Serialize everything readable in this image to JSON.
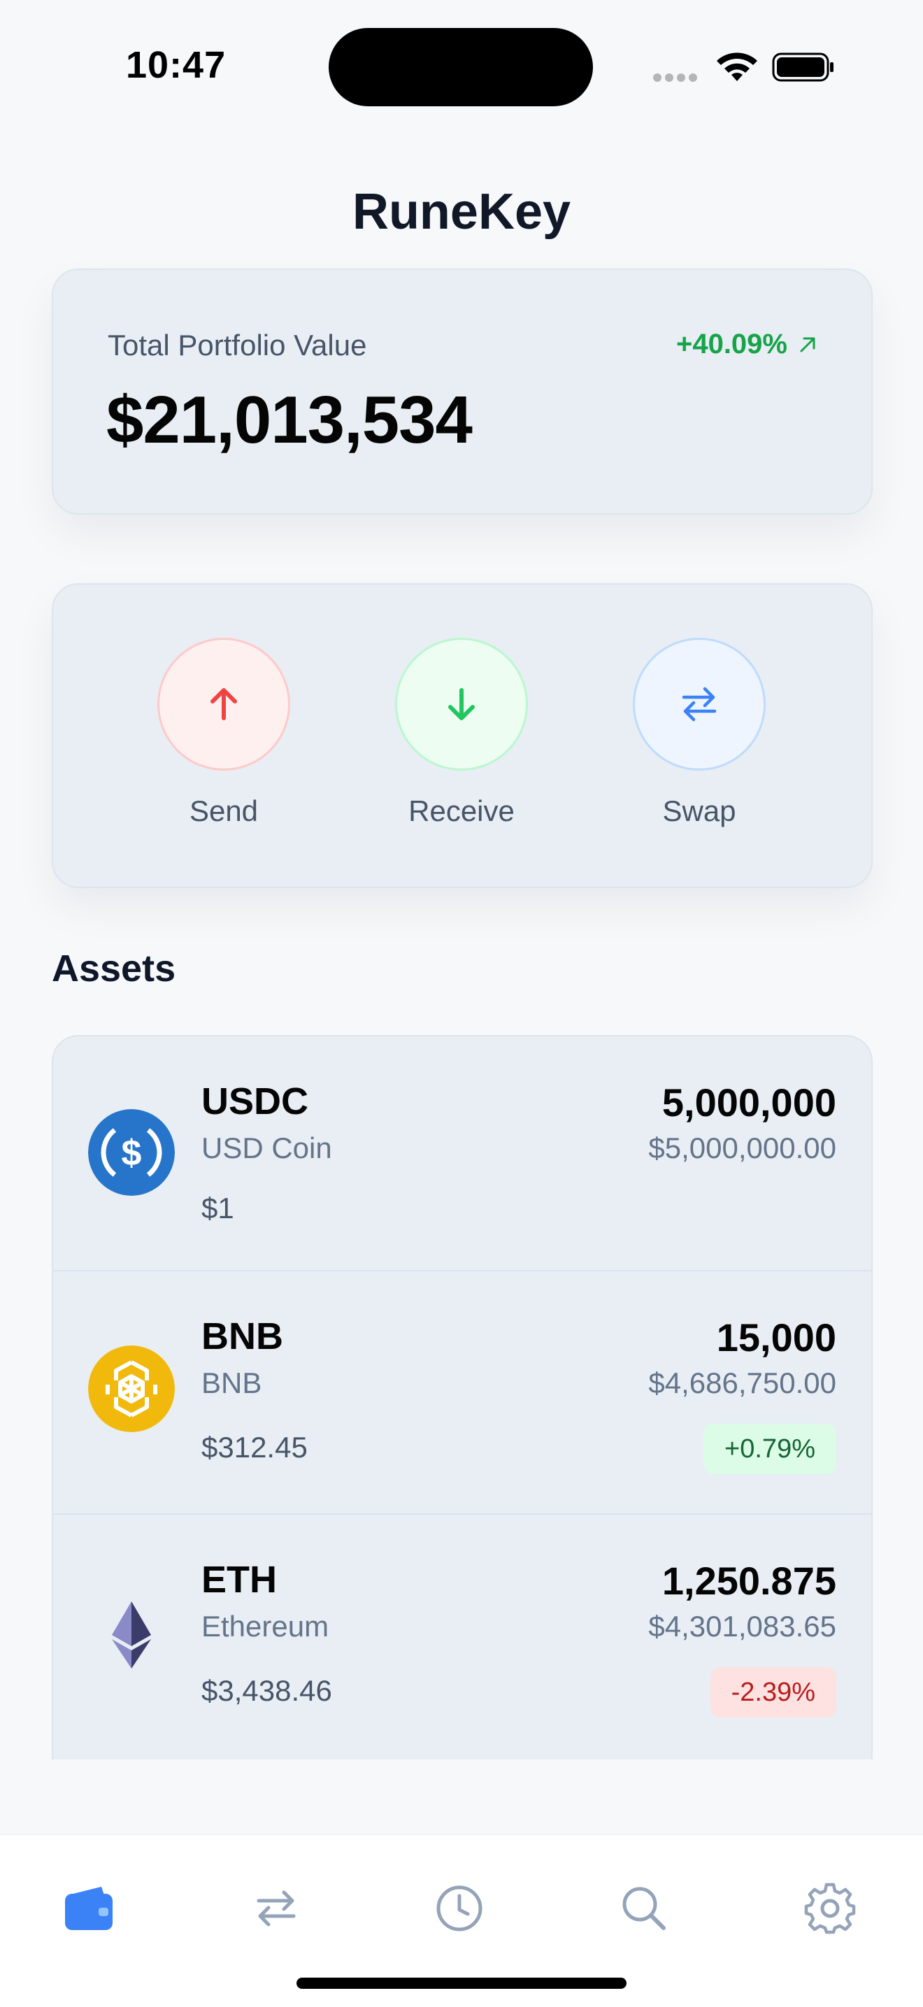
{
  "status_bar": {
    "time": "10:47"
  },
  "app": {
    "title": "RuneKey"
  },
  "portfolio": {
    "label": "Total Portfolio Value",
    "value": "$21,013,534",
    "change": "+40.09%",
    "change_icon": "arrow-up-right-icon",
    "positive_color": "#16a34a"
  },
  "actions": [
    {
      "label": "Send",
      "icon": "arrow-up-icon",
      "color": "#ef4444"
    },
    {
      "label": "Receive",
      "icon": "arrow-down-icon",
      "color": "#22c55e"
    },
    {
      "label": "Swap",
      "icon": "swap-arrows-icon",
      "color": "#3b82f6"
    }
  ],
  "assets": {
    "heading": "Assets",
    "items": [
      {
        "symbol": "USDC",
        "name": "USD Coin",
        "price": "$1",
        "amount": "5,000,000",
        "usd_value": "$5,000,000.00",
        "change": null,
        "icon": "usdc-icon"
      },
      {
        "symbol": "BNB",
        "name": "BNB",
        "price": "$312.45",
        "amount": "15,000",
        "usd_value": "$4,686,750.00",
        "change": "+0.79%",
        "icon": "bnb-icon"
      },
      {
        "symbol": "ETH",
        "name": "Ethereum",
        "price": "$3,438.46",
        "amount": "1,250.875",
        "usd_value": "$4,301,083.65",
        "change": "-2.39%",
        "icon": "ethereum-icon"
      }
    ]
  },
  "tab_bar": {
    "active_color": "#3b82f6",
    "inactive_color": "#94a3b8",
    "tabs": [
      {
        "icon": "wallet-icon",
        "active": true
      },
      {
        "icon": "swap-icon",
        "active": false
      },
      {
        "icon": "history-icon",
        "active": false
      },
      {
        "icon": "search-icon",
        "active": false
      },
      {
        "icon": "settings-icon",
        "active": false
      }
    ]
  }
}
